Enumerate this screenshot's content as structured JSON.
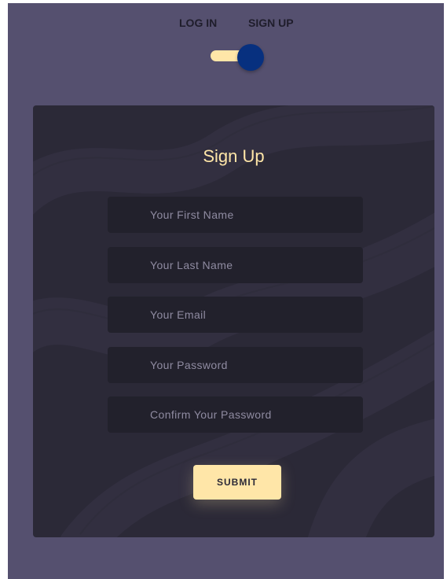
{
  "toggle": {
    "login_label": "LOG IN",
    "signup_label": "SIGN UP",
    "state": "sign-up"
  },
  "form": {
    "title": "Sign Up",
    "fields": [
      {
        "placeholder": "Your First Name",
        "value": ""
      },
      {
        "placeholder": "Your Last Name",
        "value": ""
      },
      {
        "placeholder": "Your Email",
        "value": ""
      },
      {
        "placeholder": "Your Password",
        "value": ""
      },
      {
        "placeholder": "Confirm Your Password",
        "value": ""
      }
    ],
    "submit_label": "SUBMIT"
  },
  "colors": {
    "page_bg": "#55506f",
    "card_bg": "#2b2937",
    "field_bg": "#22212c",
    "accent": "#ffe6a8",
    "toggle_knob": "#07307f"
  }
}
